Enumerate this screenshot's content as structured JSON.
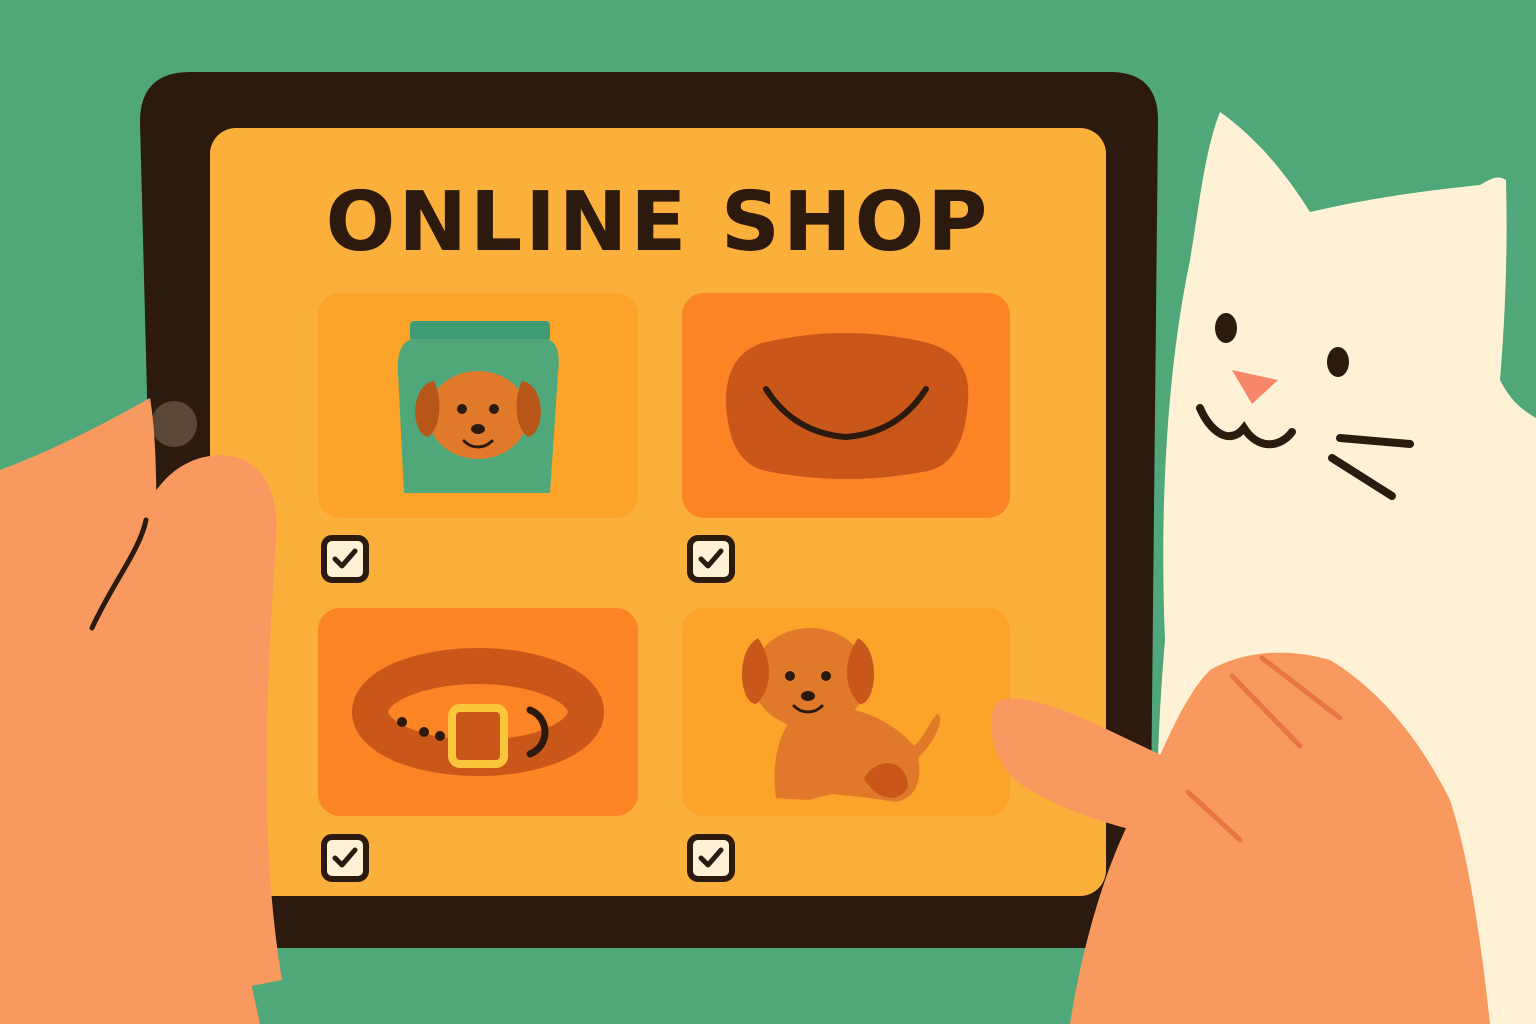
{
  "shop": {
    "title": "ONLINE SHOP",
    "products": [
      {
        "icon": "dog-food-bag-icon",
        "checked": true
      },
      {
        "icon": "pet-bed-icon",
        "checked": true
      },
      {
        "icon": "dog-collar-icon",
        "checked": true
      },
      {
        "icon": "puppy-icon",
        "checked": true
      }
    ]
  },
  "colors": {
    "background": "#4fa77a",
    "tablet_frame": "#2d1a0f",
    "screen": "#fbb03b",
    "tile_light": "#fca32a",
    "tile_orange": "#fb8424",
    "skin": "#f89a5f",
    "cat": "#fff1d6"
  }
}
